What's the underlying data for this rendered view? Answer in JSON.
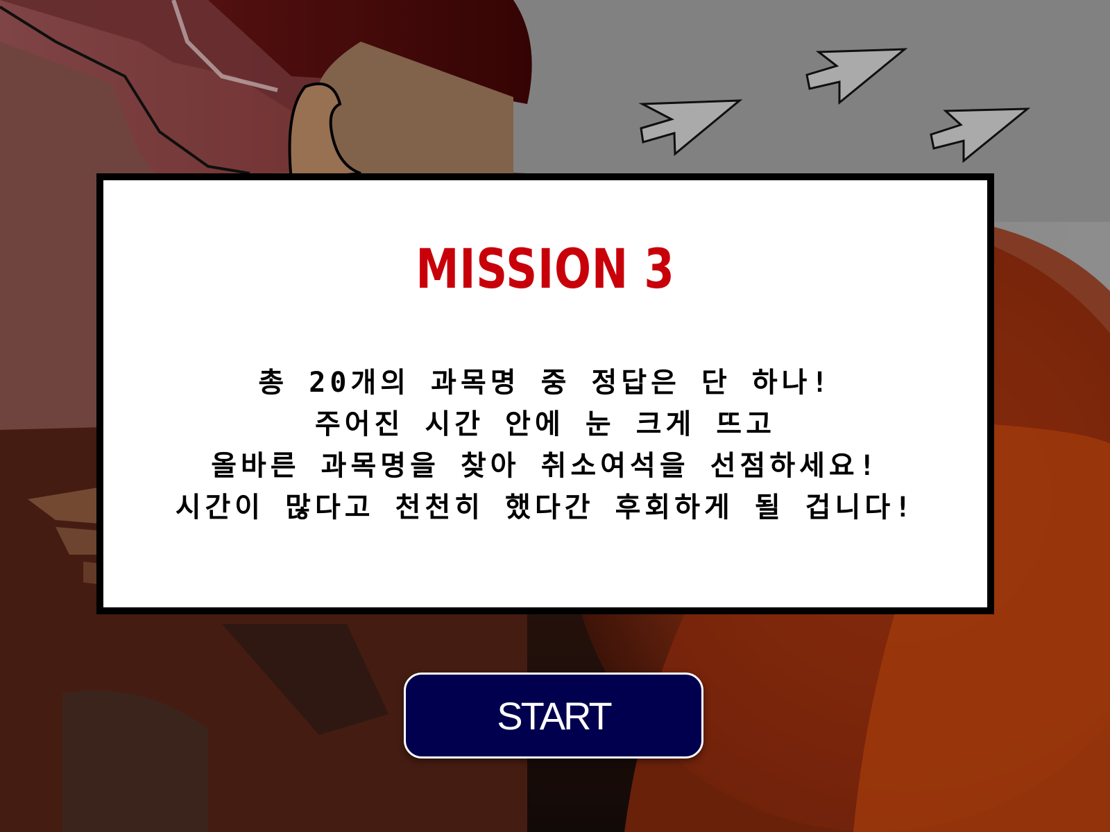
{
  "mission": {
    "title": "MISSION 3",
    "lines": [
      "총 20개의 과목명 중 정답은 단 하나!",
      "주어진 시간 안에 눈 크게 뜨고",
      "올바른 과목명을 찾아 취소여석을 선점하세요!",
      "시간이 많다고 천천히 했다간 후회하게 될 겁니다!"
    ]
  },
  "start_button": {
    "label": "START"
  },
  "colors": {
    "title_red": "#c8000a",
    "button_navy": "#00004f",
    "panel_bg": "#ffffff",
    "panel_border": "#000000"
  },
  "background": {
    "illustration": "dim comic-style scene: character profile with red headband, hand, large red-orange round shape, gray sky with three cursor-arrow icons"
  }
}
